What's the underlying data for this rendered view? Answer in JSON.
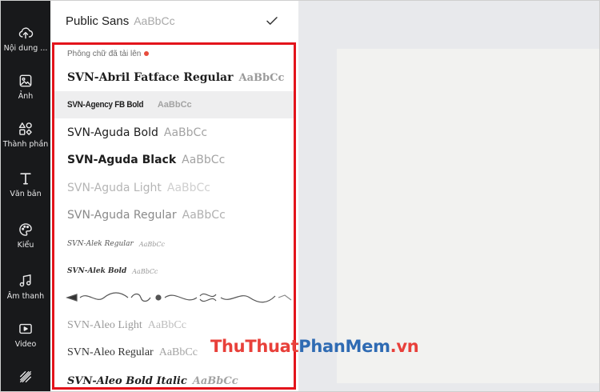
{
  "sidebar": {
    "items": [
      {
        "label": "Nội dung ...",
        "icon": "cloud-upload-icon"
      },
      {
        "label": "Ảnh",
        "icon": "image-icon"
      },
      {
        "label": "Thành phần",
        "icon": "elements-icon"
      },
      {
        "label": "Văn bản",
        "icon": "text-icon"
      },
      {
        "label": "Kiểu",
        "icon": "palette-icon"
      },
      {
        "label": "Âm thanh",
        "icon": "music-icon"
      },
      {
        "label": "Video",
        "icon": "video-icon"
      },
      {
        "label": "",
        "icon": "pattern-icon"
      }
    ]
  },
  "font_panel": {
    "current_font": {
      "name": "Public Sans",
      "sample": "AaBbCc",
      "selected_icon": "checkmark-icon"
    },
    "section_title": "Phông chữ đã tải lên",
    "fonts": [
      {
        "name": "SVN-Abril Fatface Regular",
        "sample": "AaBbCc"
      },
      {
        "name": "SVN-Agency FB Bold",
        "sample": "AaBbCc",
        "highlighted": true
      },
      {
        "name": "SVN-Aguda Bold",
        "sample": "AaBbCc"
      },
      {
        "name": "SVN-Aguda Black",
        "sample": "AaBbCc"
      },
      {
        "name": "SVN-Aguda Light",
        "sample": "AaBbCc"
      },
      {
        "name": "SVN-Aguda Regular",
        "sample": "AaBbCc"
      },
      {
        "name": "SVN-Alek Regular",
        "sample": "AaBbCc"
      },
      {
        "name": "SVN-Alek Bold",
        "sample": "AaBbCc"
      },
      {
        "name": "",
        "sample": "",
        "note": "ornament-glyph-row"
      },
      {
        "name": "SVN-Aleo Light",
        "sample": "AaBbCc"
      },
      {
        "name": "SVN-Aleo Regular",
        "sample": "AaBbCc"
      },
      {
        "name": "SVN-Aleo Bold Italic",
        "sample": "AaBbCc"
      }
    ]
  },
  "watermark": {
    "part1": "ThuThuat",
    "part2": "PhanMem",
    "part3": ".vn"
  },
  "colors": {
    "highlight_border": "#e3141b",
    "sidebar_bg": "#18191b",
    "status_dot": "#e74c3c"
  }
}
